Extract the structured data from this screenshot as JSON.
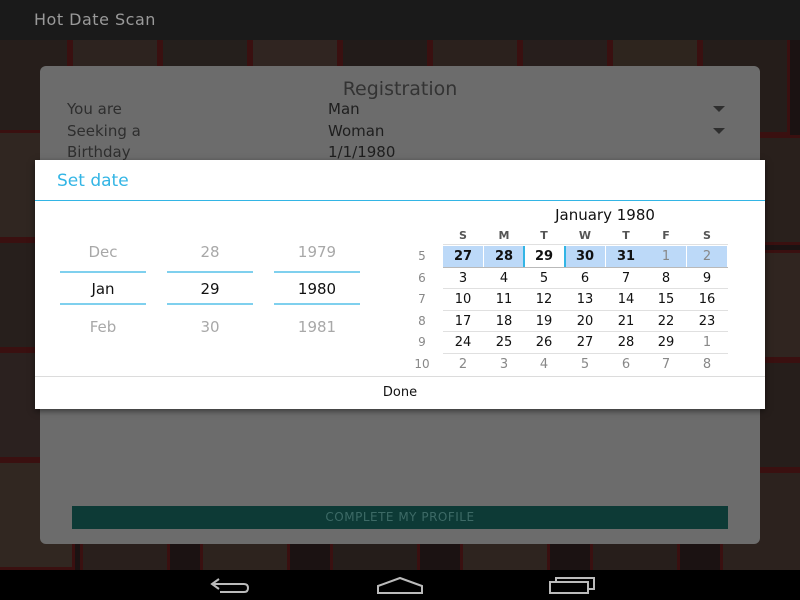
{
  "app": {
    "title": "Hot Date Scan"
  },
  "registration": {
    "title": "Registration",
    "rows": [
      {
        "label": "You are",
        "value": "Man"
      },
      {
        "label": "Seeking a",
        "value": "Woman"
      },
      {
        "label": "Birthday",
        "value": "1/1/1980"
      }
    ],
    "complete_label": "COMPLETE MY PROFILE"
  },
  "date_dialog": {
    "title": "Set date",
    "month_spinner": {
      "prev": "Dec",
      "current": "Jan",
      "next": "Feb"
    },
    "day_spinner": {
      "prev": "28",
      "current": "29",
      "next": "30"
    },
    "year_spinner": {
      "prev": "1979",
      "current": "1980",
      "next": "1981"
    },
    "calendar": {
      "month_title": "January 1980",
      "weekday_headers": [
        "S",
        "M",
        "T",
        "W",
        "T",
        "F",
        "S"
      ],
      "week_numbers": [
        "5",
        "6",
        "7",
        "8",
        "9",
        "10"
      ],
      "weeks": [
        [
          "27",
          "28",
          "29",
          "30",
          "31",
          "1",
          "2"
        ],
        [
          "3",
          "4",
          "5",
          "6",
          "7",
          "8",
          "9"
        ],
        [
          "10",
          "11",
          "12",
          "13",
          "14",
          "15",
          "16"
        ],
        [
          "17",
          "18",
          "19",
          "20",
          "21",
          "22",
          "23"
        ],
        [
          "24",
          "25",
          "26",
          "27",
          "28",
          "29",
          "1"
        ],
        [
          "2",
          "3",
          "4",
          "5",
          "6",
          "7",
          "8"
        ]
      ]
    },
    "done_label": "Done"
  },
  "colors": {
    "accent": "#33b5e5",
    "selection": "#bcd9f8",
    "button": "#0d3a36"
  },
  "navbar": {
    "icons": [
      "back-icon",
      "home-icon",
      "recent-apps-icon"
    ]
  }
}
